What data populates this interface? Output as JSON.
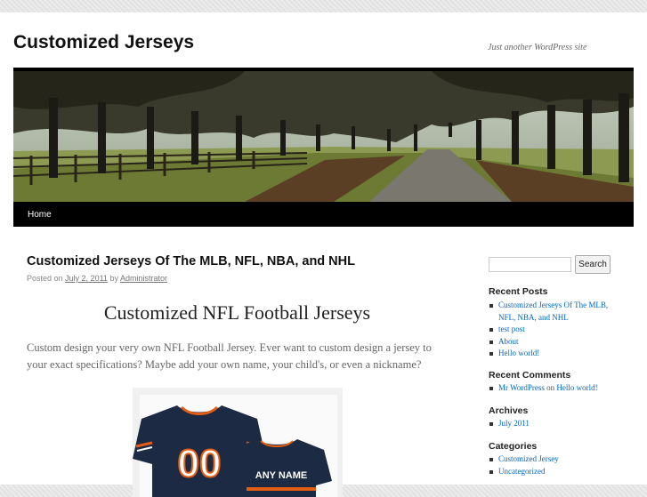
{
  "site": {
    "title": "Customized Jerseys",
    "description": "Just another WordPress site"
  },
  "nav": {
    "home": "Home"
  },
  "post": {
    "title": "Customized Jerseys Of The MLB, NFL, NBA, and NHL",
    "meta_posted_on": "Posted on",
    "meta_date": "July 2, 2011",
    "meta_by": "by",
    "meta_author": "Administrator",
    "heading": "Customized NFL Football Jerseys",
    "paragraph": "Custom design your very own NFL Football Jersey. Ever want to custom design a jersey to your exact specifications? Maybe add your own name, your child's, or even a nickname?",
    "jersey_number": "00",
    "jersey_name": "ANY NAME"
  },
  "sidebar": {
    "search_button": "Search",
    "recent_posts_title": "Recent Posts",
    "recent_posts": [
      "Customized Jerseys Of The MLB, NFL, NBA, and NHL",
      "test post",
      "About",
      "Hello world!"
    ],
    "recent_comments_title": "Recent Comments",
    "recent_comment": {
      "author": "Mr WordPress",
      "on": "on",
      "post": "Hello world!"
    },
    "archives_title": "Archives",
    "archives": [
      "July 2011"
    ],
    "categories_title": "Categories",
    "categories": [
      "Customized Jersey",
      "Uncategorized"
    ]
  },
  "colors": {
    "link": "#0066cc",
    "nav_bg": "#000000",
    "jersey_navy": "#1d2a44",
    "jersey_orange": "#e35d12"
  }
}
